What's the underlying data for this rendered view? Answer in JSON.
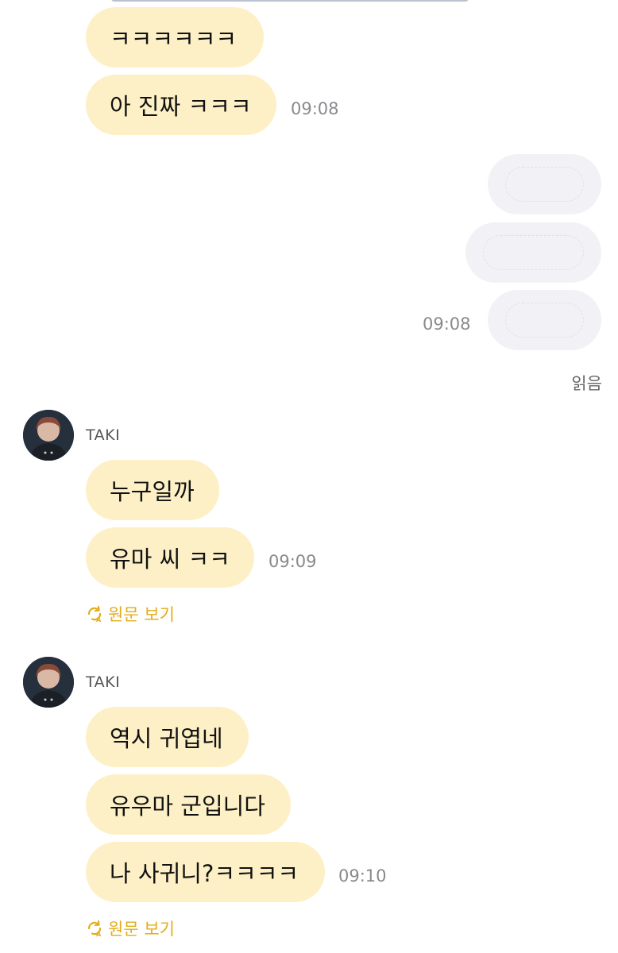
{
  "sender_name": "TAKI",
  "messages_top": {
    "bubble_1": "ㅋㅋㅋㅋㅋㅋ",
    "bubble_2": "아 진짜 ㅋㅋㅋ",
    "time": "09:08"
  },
  "outgoing": {
    "time": "09:08",
    "read_status": "읽음"
  },
  "group_1": {
    "bubble_1": "누구일까",
    "bubble_2": "유마 씨 ㅋㅋ",
    "time": "09:09",
    "translate_label": "원문 보기"
  },
  "group_2": {
    "bubble_1": "역시 귀엽네",
    "bubble_2": "유우마 군입니다",
    "bubble_3": "나 사귀니?ㅋㅋㅋㅋ",
    "time": "09:10",
    "translate_label": "원문 보기"
  },
  "colors": {
    "incoming_bubble": "#fdf0c6",
    "outgoing_bubble": "#f2f2f6",
    "translate_accent": "#e2ad1a"
  },
  "icons": {
    "translate": "refresh-translate-icon"
  }
}
